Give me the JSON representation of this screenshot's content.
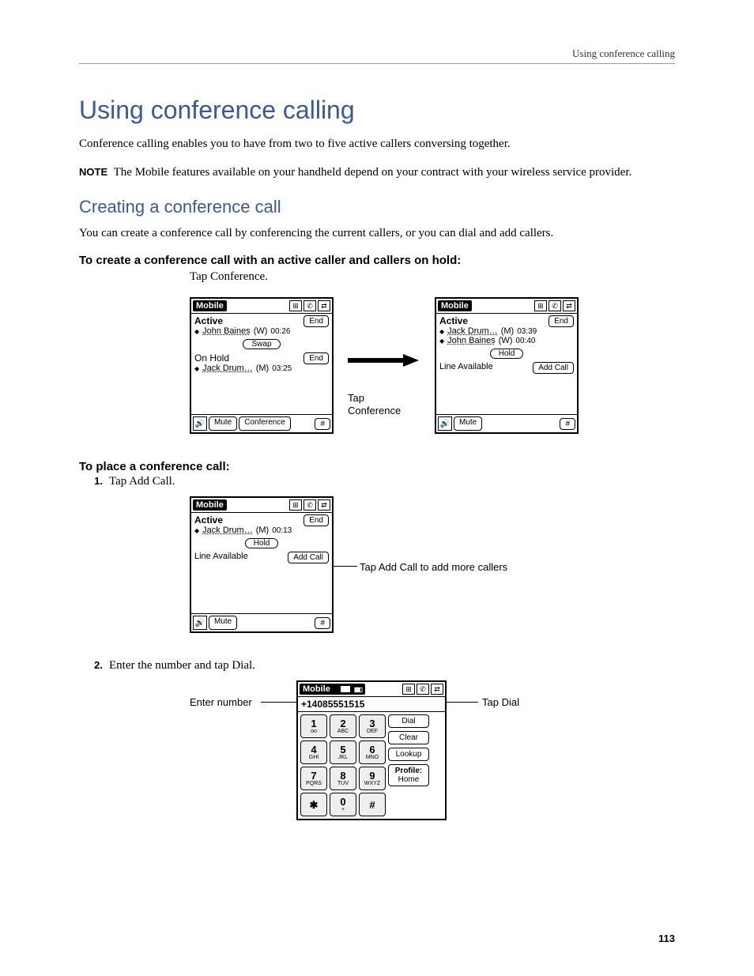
{
  "running_head": "Using conference calling",
  "h1": "Using conference calling",
  "intro": "Conference calling enables you to have from two to five active callers conversing together.",
  "note_label": "NOTE",
  "note_body": "The Mobile features available on your handheld depend on your contract with your wireless service provider.",
  "h2": "Creating a conference call",
  "create_intro": "You can create a conference call by conferencing the current callers, or you can dial and add callers.",
  "task1": "To create a conference call with an active caller and callers on hold:",
  "task1_step": "Tap Conference.",
  "arrow_label": "Tap Conference",
  "task2": "To place a conference call:",
  "step1_num": "1.",
  "step1_txt": "Tap Add Call.",
  "addcall_annot": "Tap Add Call to add more callers",
  "step2_num": "2.",
  "step2_txt": "Enter the number and tap Dial.",
  "enter_annot": "Enter number",
  "dial_annot": "Tap Dial",
  "page_number": "113",
  "screen_a": {
    "title": "Mobile",
    "active_label": "Active",
    "active_name": "John Baines",
    "active_suffix": "(W)",
    "active_time": "00:26",
    "end": "End",
    "swap": "Swap",
    "hold_label": "On Hold",
    "hold_name": "Jack Drum…",
    "hold_suffix": "(M)",
    "hold_time": "03:25",
    "mute": "Mute",
    "conference": "Conference",
    "pound": "#"
  },
  "screen_b": {
    "title": "Mobile",
    "active_label": "Active",
    "name1": "Jack Drum…",
    "suffix1": "(M)",
    "time1": "03:39",
    "name2": "John Baines",
    "suffix2": "(W)",
    "time2": "00:40",
    "end": "End",
    "hold": "Hold",
    "line_avail": "Line Available",
    "add_call": "Add Call",
    "mute": "Mute",
    "pound": "#"
  },
  "screen_c": {
    "title": "Mobile",
    "active_label": "Active",
    "name": "Jack Drum…",
    "suffix": "(M)",
    "time": "00:13",
    "end": "End",
    "hold": "Hold",
    "line_avail": "Line Available",
    "add_call": "Add Call",
    "mute": "Mute",
    "pound": "#"
  },
  "screen_d": {
    "title": "Mobile",
    "number": "+14085551515",
    "dial": "Dial",
    "clear": "Clear",
    "lookup": "Lookup",
    "profile_label": "Profile:",
    "profile_value": "Home",
    "keys": [
      {
        "n": "1",
        "s": "ᴏᴏ"
      },
      {
        "n": "2",
        "s": "ABC"
      },
      {
        "n": "3",
        "s": "DEF"
      },
      {
        "n": "4",
        "s": "GHI"
      },
      {
        "n": "5",
        "s": "JKL"
      },
      {
        "n": "6",
        "s": "MNO"
      },
      {
        "n": "7",
        "s": "PQRS"
      },
      {
        "n": "8",
        "s": "TUV"
      },
      {
        "n": "9",
        "s": "WXYZ"
      },
      {
        "n": "✱",
        "s": ""
      },
      {
        "n": "0",
        "s": "+"
      },
      {
        "n": "#",
        "s": ""
      }
    ]
  }
}
